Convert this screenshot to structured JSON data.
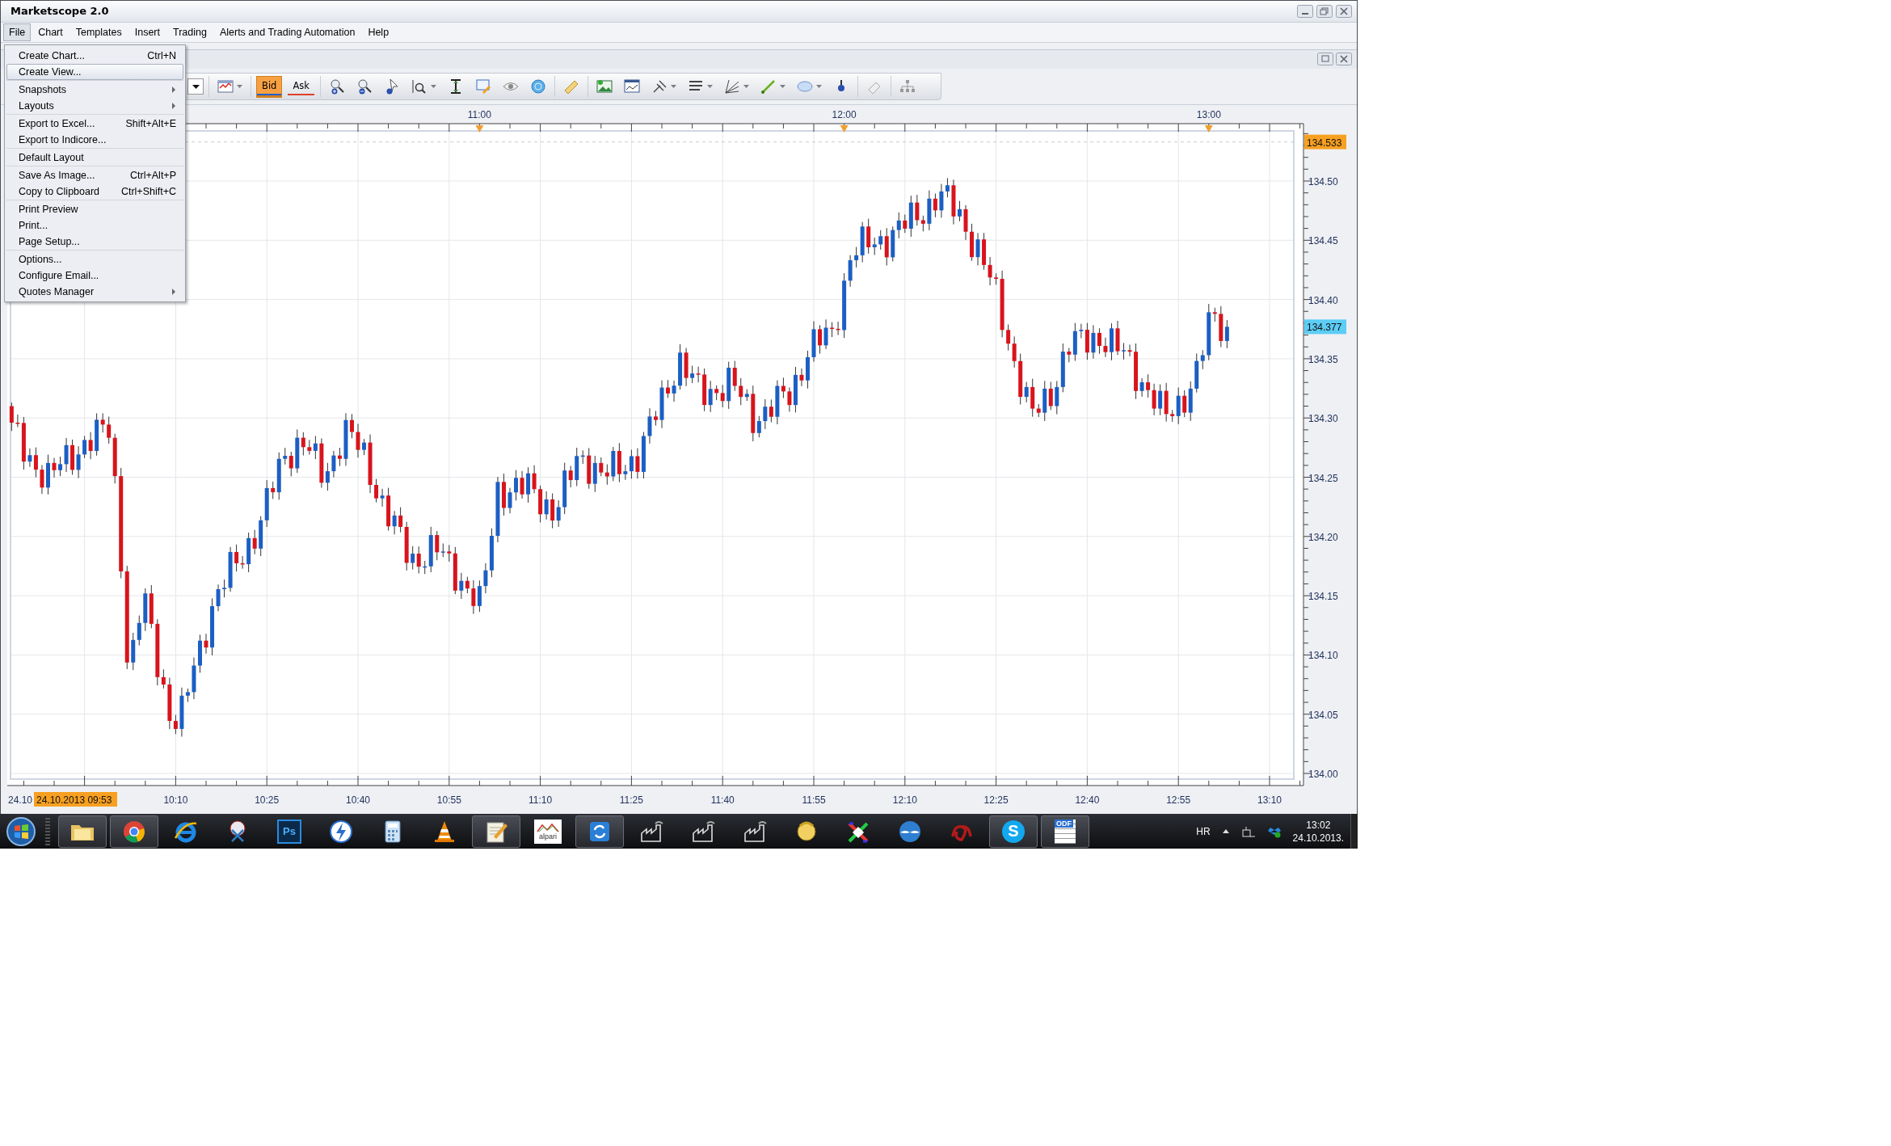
{
  "window": {
    "title": "Marketscope 2.0"
  },
  "menu_bar": [
    {
      "label": "File",
      "selected": true
    },
    {
      "label": "Chart",
      "selected": false
    },
    {
      "label": "Templates",
      "selected": false
    },
    {
      "label": "Insert",
      "selected": false
    },
    {
      "label": "Trading",
      "selected": false
    },
    {
      "label": "Alerts and Trading Automation",
      "selected": false
    },
    {
      "label": "Help",
      "selected": false
    }
  ],
  "file_menu": {
    "groups": [
      [
        {
          "label": "Create Chart...",
          "shortcut": "Ctrl+N",
          "selected": false,
          "submenu": false
        },
        {
          "label": "Create View...",
          "selected": true,
          "submenu": false
        }
      ],
      [
        {
          "label": "Snapshots",
          "selected": false,
          "submenu": true
        },
        {
          "label": "Layouts",
          "selected": false,
          "submenu": true
        }
      ],
      [
        {
          "label": "Export to Excel...",
          "shortcut": "Shift+Alt+E",
          "selected": false,
          "submenu": false
        },
        {
          "label": "Export to Indicore...",
          "selected": false,
          "submenu": false
        }
      ],
      [
        {
          "label": "Default Layout",
          "selected": false,
          "submenu": false
        }
      ],
      [
        {
          "label": "Save As Image...",
          "shortcut": "Ctrl+Alt+P",
          "selected": false,
          "submenu": false
        },
        {
          "label": "Copy to Clipboard",
          "shortcut": "Ctrl+Shift+C",
          "selected": false,
          "submenu": false
        }
      ],
      [
        {
          "label": "Print Preview",
          "selected": false,
          "submenu": false
        },
        {
          "label": "Print...",
          "selected": false,
          "submenu": false
        },
        {
          "label": "Page Setup...",
          "selected": false,
          "submenu": false
        }
      ],
      [
        {
          "label": "Options...",
          "selected": false,
          "submenu": false
        },
        {
          "label": "Configure Email...",
          "selected": false,
          "submenu": false
        },
        {
          "label": "Quotes Manager",
          "selected": false,
          "submenu": true
        }
      ]
    ]
  },
  "toolbar": {
    "price_buttons": [
      {
        "label": "Bid",
        "selected": true
      },
      {
        "label": "Ask",
        "selected": false
      }
    ]
  },
  "chart": {
    "top_time_labels": [
      "11:00",
      "12:00",
      "13:00"
    ],
    "price_labels": [
      "134.50",
      "134.45",
      "134.40",
      "134.35",
      "134.30",
      "134.25",
      "134.20",
      "134.15",
      "134.10",
      "134.05",
      "134.00"
    ],
    "high_badge": "134.533",
    "last_price_badge": "134.377",
    "time_labels": [
      "24.10",
      "10:10",
      "10:25",
      "10:40",
      "10:55",
      "11:10",
      "11:25",
      "11:40",
      "11:55",
      "12:10",
      "12:25",
      "12:40",
      "12:55",
      "13:10"
    ],
    "cursor_badge": "24.10.2013 09:53"
  },
  "taskbar": {
    "items": [
      {
        "kind": "folder",
        "open": true
      },
      {
        "kind": "chrome",
        "open": true
      },
      {
        "kind": "ie",
        "open": false
      },
      {
        "kind": "scissors",
        "open": false
      },
      {
        "kind": "photoshop",
        "label": "Ps",
        "open": false
      },
      {
        "kind": "lightning",
        "open": false
      },
      {
        "kind": "calculator",
        "open": false
      },
      {
        "kind": "cone",
        "open": false
      },
      {
        "kind": "notepad",
        "open": true
      },
      {
        "kind": "alpari",
        "label": "alpari",
        "open": false
      },
      {
        "kind": "sync",
        "open": true
      },
      {
        "kind": "factory",
        "open": false
      },
      {
        "kind": "factory",
        "open": false
      },
      {
        "kind": "factory",
        "open": false
      },
      {
        "kind": "figure",
        "open": false
      },
      {
        "kind": "cross",
        "open": false
      },
      {
        "kind": "bird",
        "open": false
      },
      {
        "kind": "swirl",
        "open": false
      },
      {
        "kind": "skype",
        "label": "S",
        "open": true
      },
      {
        "kind": "odf",
        "label": "ODF",
        "open": true
      }
    ],
    "language": "HR",
    "clock": {
      "time": "13:02",
      "date": "24.10.2013."
    }
  }
}
